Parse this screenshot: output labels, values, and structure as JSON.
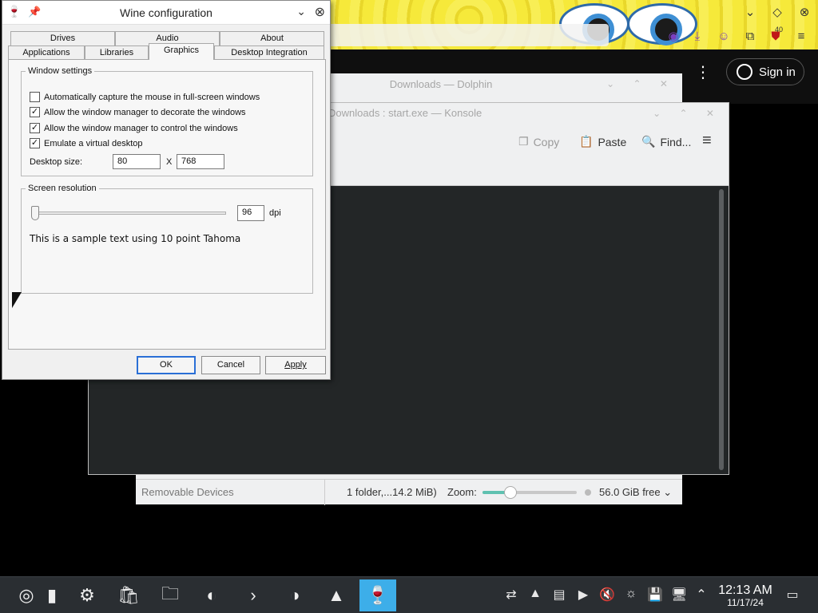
{
  "browser": {
    "sign_in_label": "Sign in",
    "badge_count": "40"
  },
  "dolphin": {
    "title": "Downloads — Dolphin",
    "removable_devices": "Removable Devices",
    "folder_info": "1 folder,...14.2 MiB)",
    "zoom_label": "Zoom:",
    "zoom_level": 0.3,
    "free_space": "56.0 GiB free"
  },
  "konsole": {
    "title": "Downloads : start.exe — Konsole",
    "copy_label": "Copy",
    "paste_label": "Paste",
    "find_label": "Find..."
  },
  "wine": {
    "title": "Wine configuration",
    "tabs_row1": [
      "Drives",
      "Audio",
      "About"
    ],
    "tabs_row2": [
      "Applications",
      "Libraries",
      "Graphics",
      "Desktop Integration"
    ],
    "active_tab": "Graphics",
    "window_settings": {
      "legend": "Window settings",
      "options": [
        {
          "label": "Automatically capture the mouse in full-screen windows",
          "checked": false
        },
        {
          "label": "Allow the window manager to decorate the windows",
          "checked": true
        },
        {
          "label": "Allow the window manager to control the windows",
          "checked": true
        },
        {
          "label": "Emulate a virtual desktop",
          "checked": true
        }
      ],
      "desktop_size_label": "Desktop size:",
      "width_value": "80",
      "x_label": "X",
      "height_value": "768"
    },
    "screen_resolution": {
      "legend": "Screen resolution",
      "dpi_value": "96",
      "dpi_unit": "dpi",
      "sample_text": "This is a sample text using 10 point Tahoma"
    },
    "buttons": {
      "ok": "OK",
      "cancel": "Cancel",
      "apply": "Apply"
    }
  },
  "taskbar": {
    "time": "12:13 AM",
    "date": "11/17/24"
  },
  "colors": {
    "accent": "#3daee9",
    "taskbar": "#2a2e32",
    "terminal_bg": "#232627",
    "default_button_border": "#2a6fd6"
  }
}
